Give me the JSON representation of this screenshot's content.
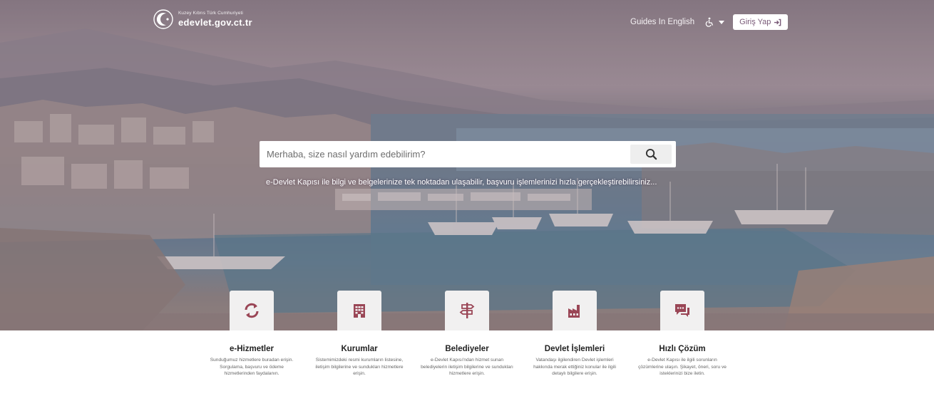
{
  "header": {
    "logo_small": "Kuzey Kıbrıs Türk Cumhuriyeti",
    "logo_big": "edevlet.gov.ct.tr",
    "guides_link": "Guides In English",
    "login_label": "Giriş Yap"
  },
  "search": {
    "placeholder": "Merhaba, size nasıl yardım edebilirim?",
    "tagline": "e-Devlet Kapısı ile bilgi ve belgelerinize tek noktadan ulaşabilir, başvuru işlemlerinizi hızla gerçekleştirebilirsiniz..."
  },
  "services": [
    {
      "title": "e-Hizmetler",
      "icon": "refresh-icon",
      "desc": "Sunduğumuz hizmetlere buradan erişin. Sorgulama, başvuru ve ödeme hizmetlerinden faydalanın."
    },
    {
      "title": "Kurumlar",
      "icon": "building-icon",
      "desc": "Sistemimizdeki resmi kurumların listesine, iletişim bilgilerine ve sundukları hizmetlere erişin."
    },
    {
      "title": "Belediyeler",
      "icon": "signpost-icon",
      "desc": "e-Devlet Kapısı'ndan hizmet sunan belediyelerin iletişim bilgilerine ve sundukları hizmetlere erişin."
    },
    {
      "title": "Devlet İşlemleri",
      "icon": "factory-icon",
      "desc": "Vatandaşı ilgilendiren Devlet işlemleri hakkında merak ettiğiniz konular ile ilgili detaylı bilgilere erişin."
    },
    {
      "title": "Hızlı Çözüm",
      "icon": "chat-icon",
      "desc": "e-Devlet Kapısı ile ilgili sorunların çözümlerine ulaşın. Şikayet, öneri, soru ve isteklerinizi bize iletin."
    }
  ],
  "colors": {
    "brand": "#7a5a78",
    "tile_icon": "#9a4656",
    "tile_bg": "#f1f0f0"
  }
}
